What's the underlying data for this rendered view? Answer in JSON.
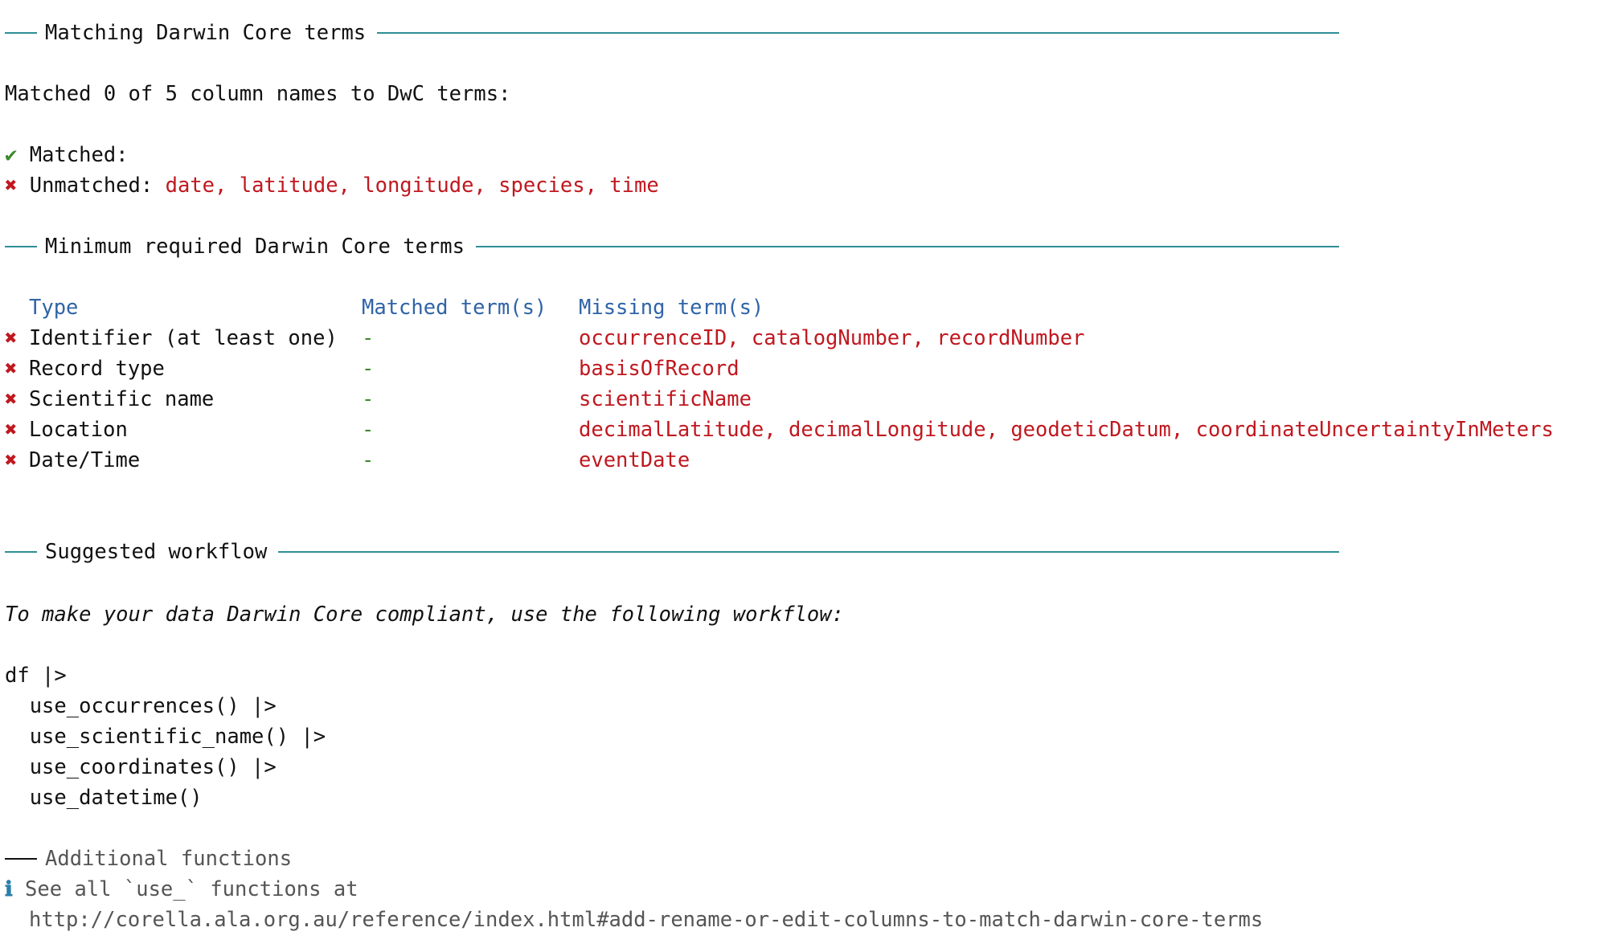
{
  "sections": {
    "matching": "Matching Darwin Core terms",
    "minimum": "Minimum required Darwin Core terms",
    "workflow": "Suggested workflow"
  },
  "matching": {
    "summary": "Matched 0 of 5 column names to DwC terms:",
    "matched_label": "Matched:",
    "unmatched_label": "Unmatched:",
    "unmatched_values": "date, latitude, longitude, species, time"
  },
  "minimum": {
    "headers": [
      "Type",
      "Matched term(s)",
      "Missing term(s)"
    ],
    "rows": [
      {
        "type": "Identifier (at least one)",
        "matched": "-",
        "missing": "occurrenceID, catalogNumber, recordNumber"
      },
      {
        "type": "Record type",
        "matched": "-",
        "missing": "basisOfRecord"
      },
      {
        "type": "Scientific name",
        "matched": "-",
        "missing": "scientificName"
      },
      {
        "type": "Location",
        "matched": "-",
        "missing": "decimalLatitude, decimalLongitude, geodeticDatum, coordinateUncertaintyInMeters"
      },
      {
        "type": "Date/Time",
        "matched": "-",
        "missing": "eventDate"
      }
    ]
  },
  "workflow": {
    "intro": "To make your data Darwin Core compliant, use the following workflow:",
    "code": [
      "df |>",
      "  use_occurrences() |>",
      "  use_scientific_name() |>",
      "  use_coordinates() |>",
      "  use_datetime()"
    ],
    "additional_title": "Additional functions",
    "see_all": "See all `use_` functions at",
    "url": "http://corella.ala.org.au/reference/index.html#add-rename-or-edit-columns-to-match-darwin-core-terms"
  },
  "icons": {
    "tick": "✔",
    "cross": "✖",
    "info": "ℹ"
  },
  "colors": {
    "rule": "#2e8f95",
    "red": "#c0181f",
    "green": "#3b8b2a",
    "blue": "#3064a8"
  }
}
